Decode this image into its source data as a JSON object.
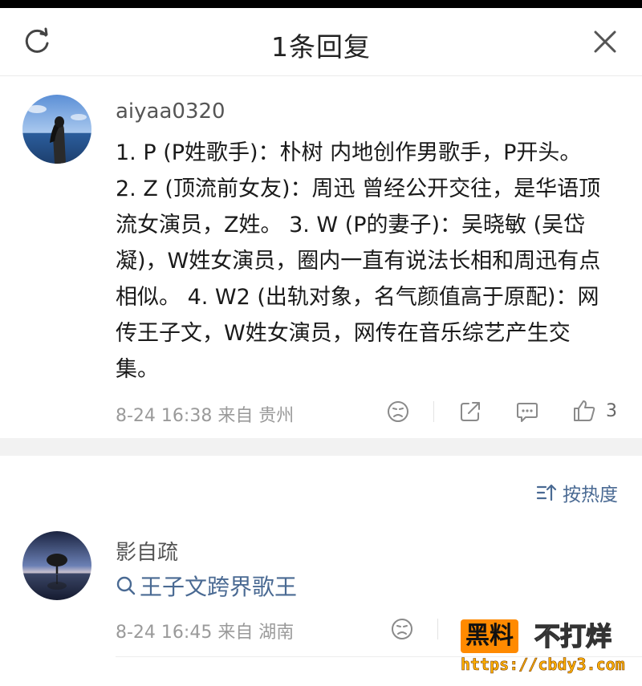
{
  "header": {
    "title": "1条回复"
  },
  "comment": {
    "username": "aiyaa0320",
    "content": "1. P (P姓歌手)：朴树 内地创作男歌手，P开头。 2. Z (顶流前女友)：周迅 曾经公开交往，是华语顶流女演员，Z姓。 3. W (P的妻子)：吴晓敏 (吴岱凝)，W姓女演员，圈内一直有说法长相和周迅有点相似。 4. W2 (出轨对象，名气颜值高于原配)：网传王子文，W姓女演员，网传在音乐综艺产生交集。",
    "meta": "8-24 16:38  来自 贵州",
    "like_count": "3"
  },
  "sort": {
    "label": "按热度"
  },
  "reply": {
    "username": "影自疏",
    "search_text": "王子文跨界歌王",
    "meta": "8-24 16:45  来自 湖南"
  },
  "watermark": {
    "brand_a": "黑料",
    "brand_b": "不打烊",
    "url": "https://cbdy3.com"
  },
  "colors": {
    "link": "#4a6a93",
    "watermark_orange": "#ff8a00"
  }
}
